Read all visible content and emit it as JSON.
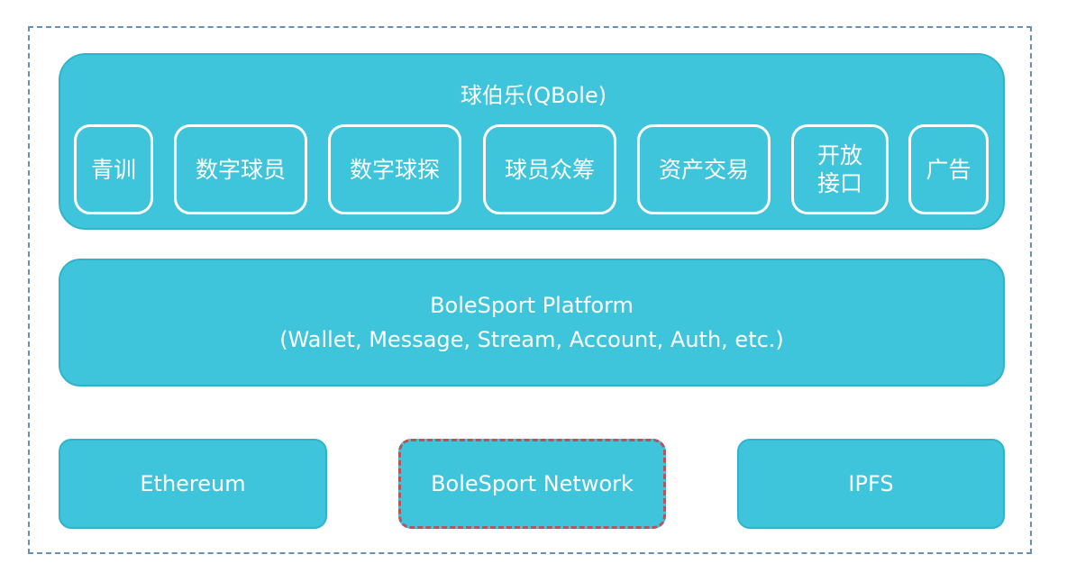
{
  "qbole": {
    "title": "球伯乐(QBole)",
    "modules": [
      {
        "label": "青训"
      },
      {
        "label": "数字球员"
      },
      {
        "label": "数字球探"
      },
      {
        "label": "球员众筹"
      },
      {
        "label": "资产交易"
      },
      {
        "label": "开放\n接口"
      },
      {
        "label": "广告"
      }
    ]
  },
  "platform": {
    "title": "BoleSport Platform",
    "subtitle": "(Wallet, Message, Stream, Account, Auth, etc.)"
  },
  "base": {
    "ethereum": "Ethereum",
    "network": "BoleSport Network",
    "ipfs": "IPFS"
  },
  "colors": {
    "box_fill": "#3ec5db",
    "frame_border": "#6a8fb5",
    "network_border": "#b5545b",
    "text": "#ffffff"
  }
}
